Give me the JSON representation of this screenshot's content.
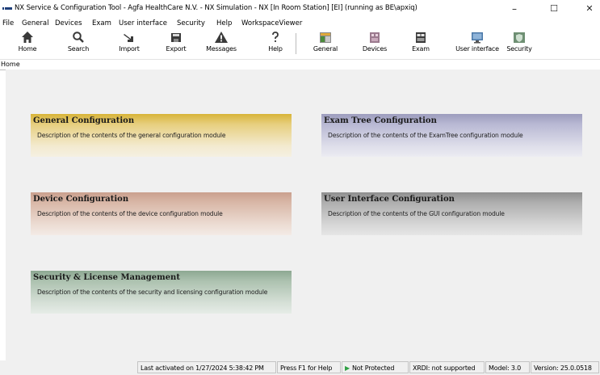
{
  "window": {
    "title": "NX Service & Configuration Tool - Agfa HealthCare N.V. - NX Simulation - NX [In Room Station] [EI] (running as BE\\apxiq)",
    "controls": {
      "minimize": "–",
      "maximize": "☐",
      "close": "✕"
    }
  },
  "menu": [
    "File",
    "General",
    "Devices",
    "Exam",
    "User interface",
    "Security",
    "Help",
    "WorkspaceViewer"
  ],
  "toolbar": {
    "left": [
      {
        "label": "Home",
        "icon": "home-icon"
      },
      {
        "label": "Search",
        "icon": "search-icon"
      },
      {
        "label": "Import",
        "icon": "import-icon"
      },
      {
        "label": "Export",
        "icon": "export-icon"
      },
      {
        "label": "Messages",
        "icon": "warning-icon"
      },
      {
        "label": "Help",
        "icon": "help-icon"
      }
    ],
    "right": [
      {
        "label": "General",
        "icon": "general-config-icon"
      },
      {
        "label": "Devices",
        "icon": "devices-icon"
      },
      {
        "label": "Exam",
        "icon": "exam-icon"
      },
      {
        "label": "User interface",
        "icon": "user-interface-icon"
      },
      {
        "label": "Security",
        "icon": "security-icon"
      }
    ]
  },
  "breadcrumb": "Home",
  "cards": {
    "general": {
      "title": "General Configuration",
      "description": "Description of the contents of the general configuration module",
      "color": "#d8b438"
    },
    "exam": {
      "title": "Exam Tree Configuration",
      "description": "Description of the contents of the ExamTree configuration module",
      "color": "#9d9dbd"
    },
    "device": {
      "title": "Device Configuration",
      "description": "Description of the contents of the device configuration module",
      "color": "#caa08e"
    },
    "ui": {
      "title": "User Interface Configuration",
      "description": "Description of the contents of the GUI configuration module",
      "color": "#8f8f8f"
    },
    "security": {
      "title": "Security & License Management",
      "description": "Description of the contents of the security and licensing configuration module",
      "color": "#8da892"
    }
  },
  "status": {
    "last_activated": "Last activated on 1/27/2024 5:38:42 PM",
    "help_hint": "Press F1 for Help",
    "protection": "Not Protected",
    "xrdi": "XRDI: not supported",
    "model": "Model: 3.0",
    "version": "Version: 25.0.0518"
  }
}
